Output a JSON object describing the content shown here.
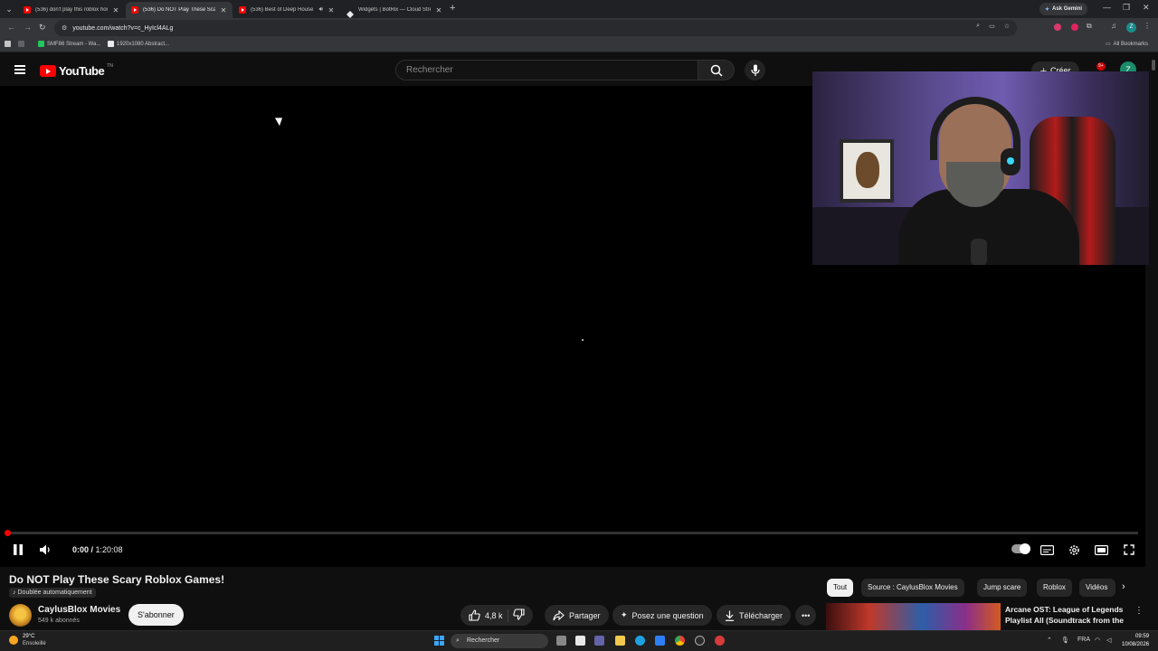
{
  "browser": {
    "tabs": [
      {
        "title": "(536) don't play this roblox hor",
        "active": false,
        "audio": false
      },
      {
        "title": "(536) Do NOT Play These Scary",
        "active": true,
        "audio": false
      },
      {
        "title": "(536) Best of Deep House",
        "active": false,
        "audio": true
      },
      {
        "title": "Widgets | BotRix — Cloud Strea",
        "active": false,
        "audio": false
      }
    ],
    "ask_gemini": "Ask Gemini",
    "url": "youtube.com/watch?v=c_HyIcl4ALg",
    "bookmarks": [
      "SMF86 Stream - Wa...",
      "1920x1080 Abstract..."
    ],
    "all_bookmarks": "All Bookmarks",
    "profile_initial": "Z"
  },
  "youtube": {
    "logo_text": "YouTube",
    "country_code": "TN",
    "search_placeholder": "Rechercher",
    "create_label": "Créer",
    "notifications_count": "9+",
    "avatar_initial": "Z"
  },
  "player": {
    "current_time": "0:00",
    "duration": "1:20:08",
    "progress": 0,
    "autoplay": true
  },
  "video": {
    "title": "Do NOT Play These Scary Roblox Games!",
    "dubbed_label": "Doublée automatiquement",
    "channel_name": "CaylusBlox Movies",
    "subscribers": "549 k abonnés",
    "subscribe_label": "S'abonner",
    "likes": "4,8 k",
    "share_label": "Partager",
    "ask_label": "Posez une question",
    "download_label": "Télécharger"
  },
  "chips": [
    {
      "label": "Tout",
      "selected": true
    },
    {
      "label": "Source : CaylusBlox Movies",
      "selected": false
    },
    {
      "label": "Jump scare",
      "selected": false
    },
    {
      "label": "Roblox",
      "selected": false
    },
    {
      "label": "Vidéos",
      "selected": false
    }
  ],
  "recommendation": {
    "title": "Arcane OST: League of Legends Playlist All (Soundtrack from the ..."
  },
  "taskbar": {
    "temperature": "29°C",
    "weather": "Ensoleillé",
    "search_label": "Rechercher",
    "language": "FRA",
    "time": "09:59",
    "date": "10/08/2026"
  }
}
